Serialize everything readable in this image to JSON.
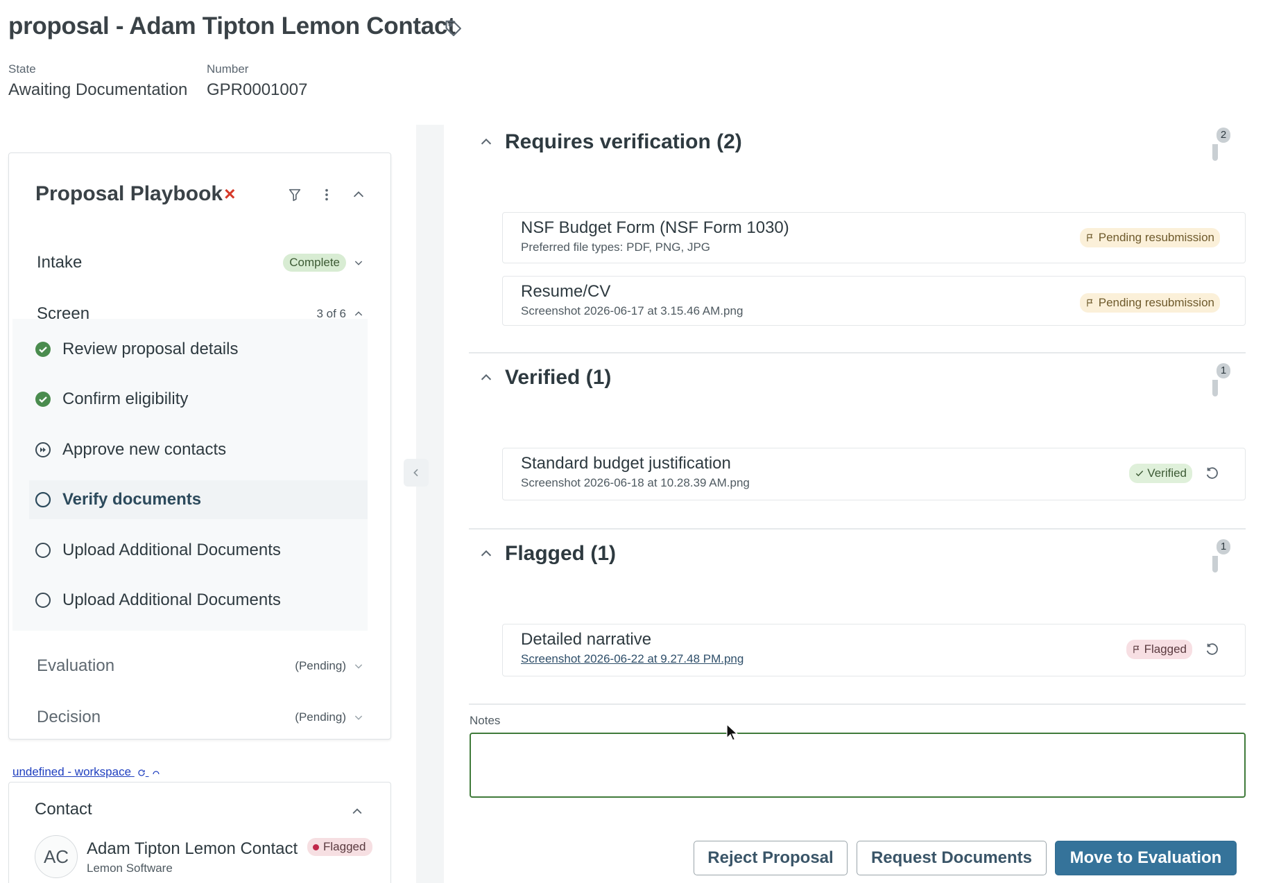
{
  "page": {
    "title": "proposal - Adam Tipton Lemon Contact",
    "state_label": "State",
    "state_value": "Awaiting Documentation",
    "number_label": "Number",
    "number_value": "GPR0001007"
  },
  "playbook": {
    "title": "Proposal Playbook",
    "title_mark": "×",
    "stages": [
      {
        "name": "Intake",
        "status": "Complete"
      },
      {
        "name": "Screen",
        "status": "3 of 6"
      },
      {
        "name": "Evaluation",
        "status": "(Pending)"
      },
      {
        "name": "Decision",
        "status": "(Pending)"
      }
    ],
    "tasks": [
      {
        "label": "Review proposal details",
        "state": "done"
      },
      {
        "label": "Confirm eligibility",
        "state": "done"
      },
      {
        "label": "Approve new contacts",
        "state": "skipped"
      },
      {
        "label": "Verify documents",
        "state": "active"
      },
      {
        "label": "Upload Additional Documents",
        "state": "todo"
      },
      {
        "label": "Upload Additional Documents",
        "state": "todo"
      }
    ]
  },
  "workspace_link": "undefined - workspace",
  "contact": {
    "heading": "Contact",
    "initials": "AC",
    "name": "Adam Tipton Lemon Contact",
    "org": "Lemon Software",
    "badge": "Flagged"
  },
  "sections": {
    "requires": {
      "title": "Requires verification (2)",
      "count": "2",
      "docs": [
        {
          "title": "NSF Budget Form (NSF Form 1030)",
          "sub": "Preferred file types: PDF, PNG, JPG",
          "badge": "Pending resubmission"
        },
        {
          "title": "Resume/CV",
          "sub": "Screenshot 2026-06-17 at 3.15.46 AM.png",
          "badge": "Pending resubmission"
        }
      ]
    },
    "verified": {
      "title": "Verified (1)",
      "count": "1",
      "docs": [
        {
          "title": "Standard budget justification",
          "sub": "Screenshot 2026-06-18 at 10.28.39 AM.png",
          "badge": "Verified"
        }
      ]
    },
    "flagged": {
      "title": "Flagged (1)",
      "count": "1",
      "docs": [
        {
          "title": "Detailed narrative",
          "sub": "Screenshot 2026-06-22 at 9.27.48 PM.png",
          "badge": "Flagged"
        }
      ]
    }
  },
  "notes": {
    "label": "Notes",
    "value": ""
  },
  "actions": {
    "reject": "Reject Proposal",
    "request": "Request Documents",
    "move": "Move to Evaluation"
  },
  "colors": {
    "primary": "#35739a",
    "complete_bg": "#d8ecd3",
    "pending_bg": "#fbf0d9",
    "flagged_bg": "#f7dfe3",
    "verified_bg": "#dff0da",
    "check_green": "#4a8c4e",
    "notes_border": "#3f7a3a"
  },
  "icons": {
    "title": "tag-icon",
    "playbook": [
      "filter-icon",
      "more-vertical-icon",
      "chevron-up-icon"
    ],
    "task_done": "check-circle-icon",
    "task_skipped": "skip-circle-icon",
    "task_todo": "empty-circle-icon",
    "pending": "flag-icon",
    "verified": "check-icon",
    "undo": "undo-icon",
    "workspace": [
      "refresh-icon",
      "external-link-icon"
    ]
  }
}
